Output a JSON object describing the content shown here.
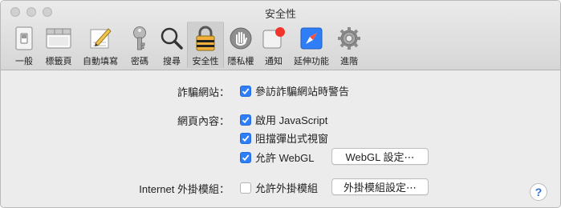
{
  "window": {
    "title": "安全性"
  },
  "toolbar": {
    "items": [
      {
        "label": "一般",
        "icon": "general-switch-icon",
        "active": false
      },
      {
        "label": "標籤頁",
        "icon": "tabs-icon",
        "active": false
      },
      {
        "label": "自動填寫",
        "icon": "pencil-icon",
        "active": false
      },
      {
        "label": "密碼",
        "icon": "key-icon",
        "active": false
      },
      {
        "label": "搜尋",
        "icon": "search-icon",
        "active": false
      },
      {
        "label": "安全性",
        "icon": "lock-icon",
        "active": true
      },
      {
        "label": "隱私權",
        "icon": "hand-icon",
        "active": false
      },
      {
        "label": "通知",
        "icon": "notification-icon",
        "active": false
      },
      {
        "label": "延伸功能",
        "icon": "extensions-icon",
        "active": false
      },
      {
        "label": "進階",
        "icon": "gear-icon",
        "active": false
      }
    ]
  },
  "fraud": {
    "label": "詐騙網站：",
    "checkbox_label": "參訪詐騙網站時警告",
    "checked": true
  },
  "web_content": {
    "label": "網頁內容：",
    "options": [
      {
        "label": "啟用 JavaScript",
        "checked": true
      },
      {
        "label": "阻擋彈出式視窗",
        "checked": true
      },
      {
        "label": "允許 WebGL",
        "checked": true
      }
    ],
    "webgl_button": "WebGL 設定⋯"
  },
  "plugins": {
    "label": "Internet 外掛模組：",
    "checkbox_label": "允許外掛模組",
    "checked": false,
    "button": "外掛模組設定⋯"
  },
  "help": {
    "label": "?"
  },
  "colors": {
    "accent": "#2f7ef7",
    "background": "#ececec"
  }
}
